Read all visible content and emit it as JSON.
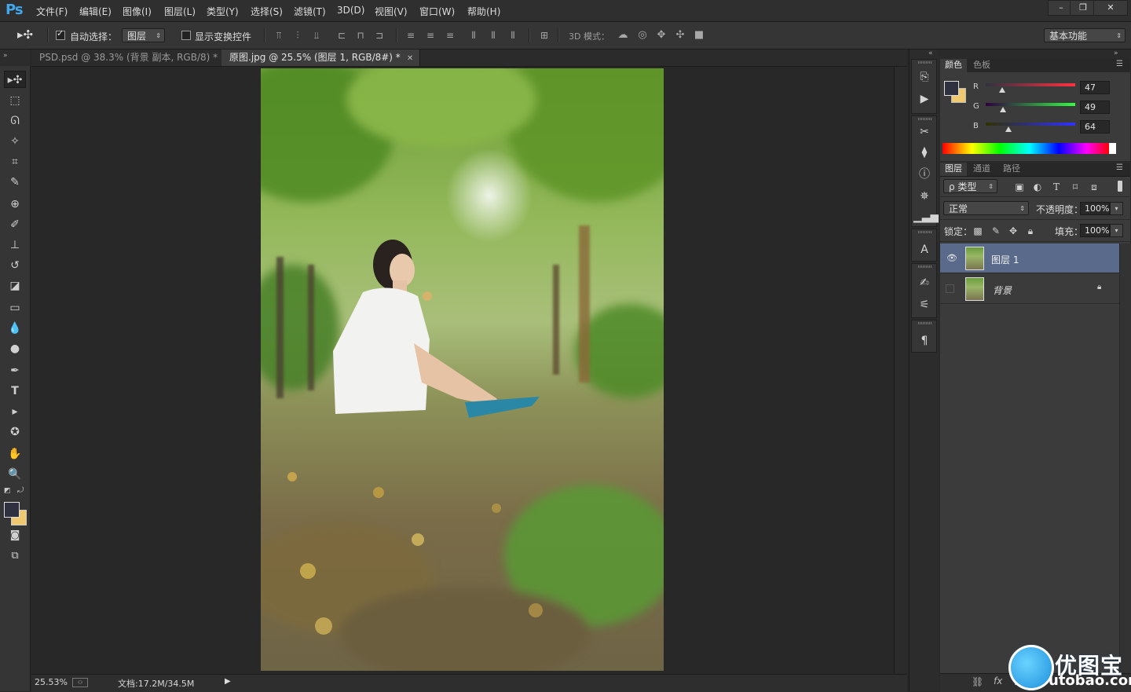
{
  "app": {
    "logo": "Ps"
  },
  "menu": [
    "文件(F)",
    "编辑(E)",
    "图像(I)",
    "图层(L)",
    "类型(Y)",
    "选择(S)",
    "滤镜(T)",
    "3D(D)",
    "视图(V)",
    "窗口(W)",
    "帮助(H)"
  ],
  "window_controls": {
    "minimize": "–",
    "restore": "❐",
    "close": "✕"
  },
  "options": {
    "auto_select_label": "自动选择：",
    "auto_select_checked": true,
    "auto_select_target": "图层",
    "show_transform_label": "显示变换控件",
    "show_transform_checked": false,
    "mode_3d_label": "3D 模式：",
    "workspace": "基本功能"
  },
  "tabs": [
    {
      "label": "PSD.psd @ 38.3% (背景 副本, RGB/8) *",
      "active": false
    },
    {
      "label": "原图.jpg @ 25.5% (图层 1, RGB/8#) *",
      "active": true
    }
  ],
  "status": {
    "zoom": "25.53%",
    "doc_info": "文档:17.2M/34.5M"
  },
  "color_panel": {
    "tabs": [
      "颜色",
      "色板"
    ],
    "fg_color": "#2f3140",
    "bg_color": "#f0c870",
    "channels": [
      {
        "label": "R",
        "value": "47",
        "fraction": 0.184
      },
      {
        "label": "G",
        "value": "49",
        "fraction": 0.192
      },
      {
        "label": "B",
        "value": "64",
        "fraction": 0.251
      }
    ]
  },
  "layers_panel": {
    "tabs": [
      "图层",
      "通道",
      "路径"
    ],
    "filter_kind": "ρ 类型",
    "blend_mode": "正常",
    "opacity_label": "不透明度：",
    "opacity": "100%",
    "lock_label": "锁定：",
    "fill_label": "填充：",
    "fill": "100%",
    "layers": [
      {
        "name": "图层 1",
        "visible": true,
        "selected": true,
        "locked": false
      },
      {
        "name": "背景",
        "visible": false,
        "selected": false,
        "locked": true
      }
    ]
  },
  "watermark": {
    "text": "优图宝",
    "url": "utobao.com"
  }
}
